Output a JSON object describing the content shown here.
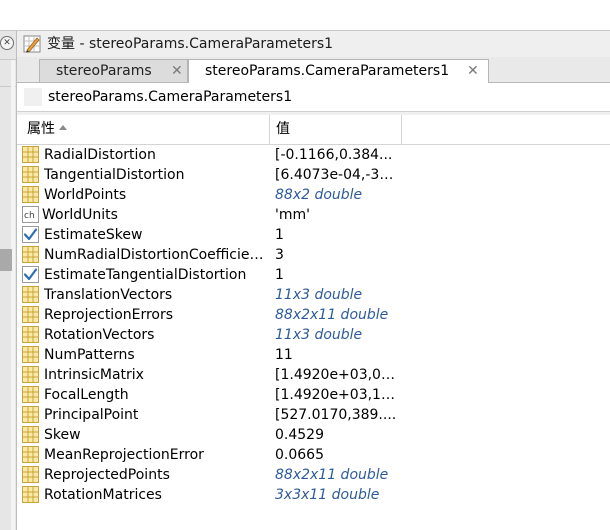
{
  "window": {
    "title": "变量 - stereoParams.CameraParameters1",
    "close_glyph": "✕"
  },
  "tabs": [
    {
      "label": "stereoParams",
      "close_glyph": "✕",
      "active": false
    },
    {
      "label": "stereoParams.CameraParameters1",
      "close_glyph": "✕",
      "active": true
    }
  ],
  "breadcrumb": {
    "text": "stereoParams.CameraParameters1"
  },
  "table": {
    "columns": {
      "property": "属性",
      "value": "值"
    },
    "rows": [
      {
        "name": "RadialDistortion",
        "value": "[-0.1166,0.384...",
        "icon": "matrix-icon",
        "style": "normal"
      },
      {
        "name": "TangentialDistortion",
        "value": "[6.4073e-04,-3....",
        "icon": "matrix-icon",
        "style": "normal"
      },
      {
        "name": "WorldPoints",
        "value": "88x2 double",
        "icon": "matrix-icon",
        "style": "italic"
      },
      {
        "name": "WorldUnits",
        "value": "'mm'",
        "icon": "char-icon",
        "style": "normal"
      },
      {
        "name": "EstimateSkew",
        "value": "1",
        "icon": "logical-icon",
        "style": "normal"
      },
      {
        "name": "NumRadialDistortionCoefficients",
        "value": "3",
        "icon": "matrix-icon",
        "style": "normal"
      },
      {
        "name": "EstimateTangentialDistortion",
        "value": "1",
        "icon": "logical-icon",
        "style": "normal"
      },
      {
        "name": "TranslationVectors",
        "value": "11x3 double",
        "icon": "matrix-icon",
        "style": "italic"
      },
      {
        "name": "ReprojectionErrors",
        "value": "88x2x11 double",
        "icon": "matrix-icon",
        "style": "italic"
      },
      {
        "name": "RotationVectors",
        "value": "11x3 double",
        "icon": "matrix-icon",
        "style": "italic"
      },
      {
        "name": "NumPatterns",
        "value": "11",
        "icon": "matrix-icon",
        "style": "normal"
      },
      {
        "name": "IntrinsicMatrix",
        "value": "[1.4920e+03,0,...",
        "icon": "matrix-icon",
        "style": "normal"
      },
      {
        "name": "FocalLength",
        "value": "[1.4920e+03,1....",
        "icon": "matrix-icon",
        "style": "normal"
      },
      {
        "name": "PrincipalPoint",
        "value": "[527.0170,389....",
        "icon": "matrix-icon",
        "style": "normal"
      },
      {
        "name": "Skew",
        "value": "0.4529",
        "icon": "matrix-icon",
        "style": "normal"
      },
      {
        "name": "MeanReprojectionError",
        "value": "0.0665",
        "icon": "matrix-icon",
        "style": "normal"
      },
      {
        "name": "ReprojectedPoints",
        "value": "88x2x11 double",
        "icon": "matrix-icon",
        "style": "italic"
      },
      {
        "name": "RotationMatrices",
        "value": "3x3x11 double",
        "icon": "matrix-icon",
        "style": "italic"
      }
    ]
  },
  "colors": {
    "matrix_icon_border": "#c8a23c",
    "matrix_icon_fill": "#fbe9a3",
    "check_color": "#2b6fb6",
    "italic_value": "#2d5b99"
  }
}
